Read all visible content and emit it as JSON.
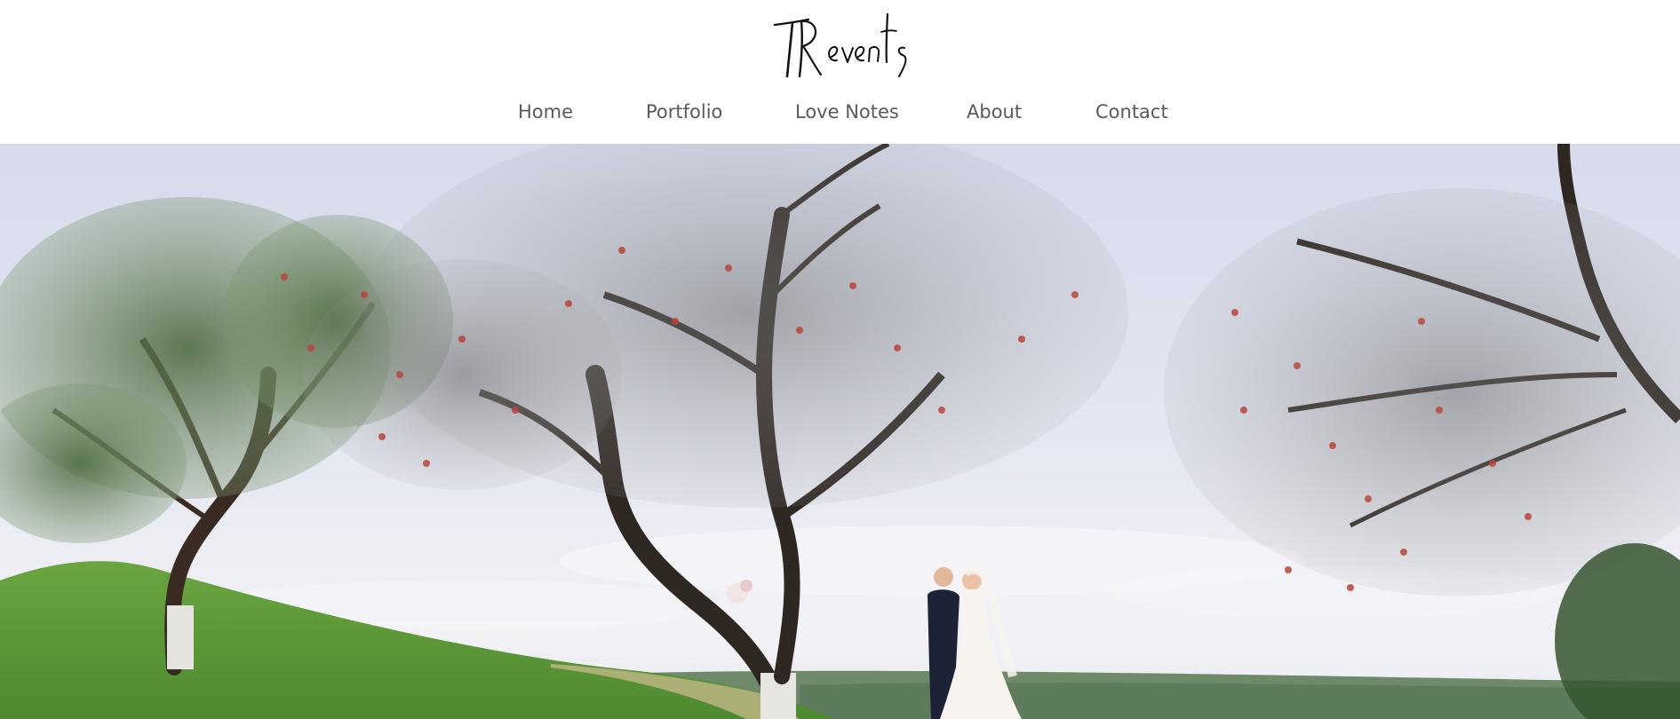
{
  "site": {
    "logo_text": "TR events"
  },
  "nav": {
    "items": [
      {
        "label": "Home"
      },
      {
        "label": "Portfolio"
      },
      {
        "label": "Love Notes"
      },
      {
        "label": "About"
      },
      {
        "label": "Contact"
      }
    ]
  },
  "hero": {
    "image_alt": "Bride and groom standing among apple trees on a grassy hill overlooking a valley"
  },
  "colors": {
    "nav_text": "#5a5a5a",
    "logo_ink": "#111111",
    "sky": "#dfe2ee",
    "grass": "#5e9a3a",
    "background": "#ffffff"
  }
}
